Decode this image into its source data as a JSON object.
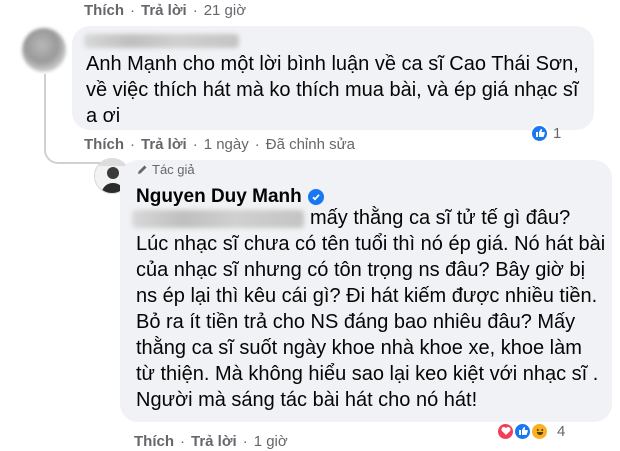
{
  "comment_top": {
    "like_label": "Thích",
    "reply_label": "Trả lời",
    "time": "21 giờ"
  },
  "comment1": {
    "text": "Anh Mạnh cho một lời bình luận về ca sĩ Cao Thái Sơn, về việc thích hát mà ko thích mua bài, và ép giá nhạc sĩ a ơi",
    "like_label": "Thích",
    "reply_label": "Trả lời",
    "time": "1 ngày",
    "edited_label": "Đã chỉnh sửa",
    "reaction_count": "1"
  },
  "reply": {
    "author_badge": "Tác giả",
    "author_name": "Nguyen Duy Manh",
    "first_line": "mấy thằng ca sĩ tử tế gì đâu?",
    "text": "Lúc nhạc sĩ chưa có tên tuổi thì nó ép giá. Nó hát bài của nhạc sĩ nhưng có tôn trọng ns đâu? Bây giờ bị ns ép lại thì kêu cái gì? Đi hát kiếm được nhiều tiền. Bỏ ra ít tiền trả cho NS đáng bao nhiêu đâu? Mấy thằng ca sĩ suốt ngày khoe nhà khoe xe, khoe làm từ thiện. Mà không hiểu sao lại keo kiệt với nhạc sĩ . Người mà sáng tác bài hát cho nó hát!",
    "like_label": "Thích",
    "reply_label": "Trả lời",
    "time": "1 giờ",
    "reaction_count": "4"
  },
  "icons": {
    "like": "like-icon",
    "love": "love-icon",
    "haha": "haha-icon",
    "verified": "verified-badge-icon",
    "author": "pen-icon"
  },
  "colors": {
    "bubble": "#f0f2f5",
    "meta_text": "#65676b",
    "like_blue": "#1877f2",
    "love_red": "#f33e58",
    "haha_yellow": "#f7b125"
  }
}
